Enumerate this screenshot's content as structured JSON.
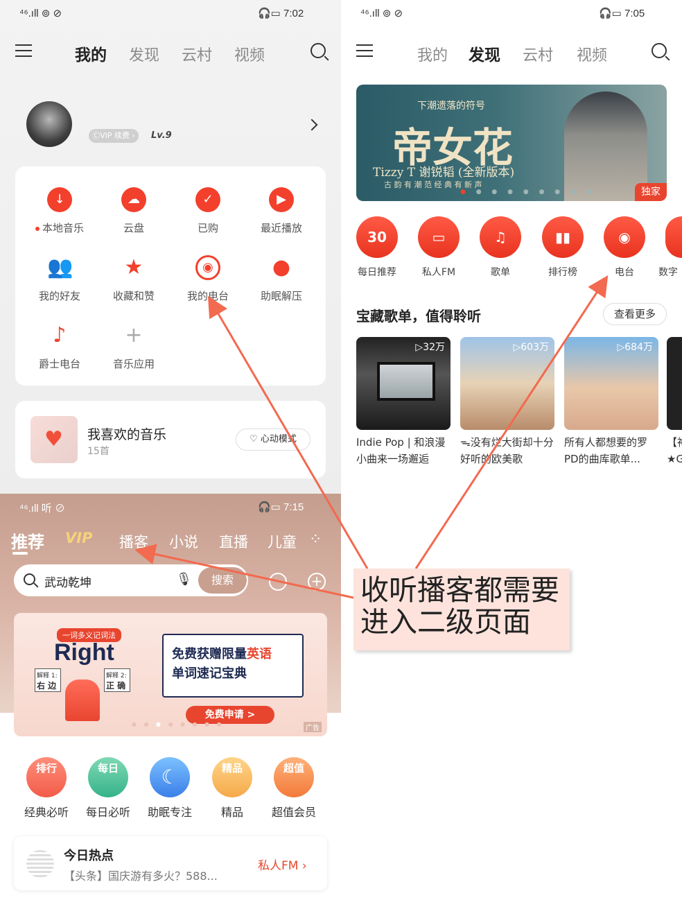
{
  "colors": {
    "accent": "#f2402d",
    "annotation_bg": "#fde3dc",
    "arrow": "#f26a4f"
  },
  "panel_a": {
    "status": {
      "left": "⁴⁶.ıll ⊚ ⊘",
      "time": "7:02"
    },
    "tabs": [
      "我的",
      "发现",
      "云村",
      "视频"
    ],
    "profile": {
      "vip_badge": "ⒸVIP 续费 ›",
      "level": "Lv.9"
    },
    "grid": [
      {
        "label": "本地音乐",
        "icon": "download-icon"
      },
      {
        "label": "云盘",
        "icon": "cloud-upload-icon"
      },
      {
        "label": "已购",
        "icon": "check-icon"
      },
      {
        "label": "最近播放",
        "icon": "play-icon"
      },
      {
        "label": "我的好友",
        "icon": "friends-icon"
      },
      {
        "label": "收藏和赞",
        "icon": "star-icon"
      },
      {
        "label": "我的电台",
        "icon": "radio-icon"
      },
      {
        "label": "助眠解压",
        "icon": "moon-icon"
      },
      {
        "label": "爵士电台",
        "icon": "saxophone-icon"
      },
      {
        "label": "音乐应用",
        "icon": "plus-icon"
      }
    ],
    "liked": {
      "title": "我喜欢的音乐",
      "count": "15首",
      "mode": "心动模式"
    }
  },
  "panel_b": {
    "status": {
      "left": "⁴⁶.ıll ⊚ ⊘",
      "time": "7:05"
    },
    "tabs": [
      "我的",
      "发现",
      "云村",
      "视频"
    ],
    "banner": {
      "top_text": "下潮遗落的符号",
      "title": "帝女花",
      "subtitle": "Tizzy T 谢锐韬 (全新版本)",
      "tagline": "古 韵 有 潮 范   经 典 有 新 声",
      "badge": "独家"
    },
    "categories": [
      {
        "label": "每日推荐",
        "icon_text": "30"
      },
      {
        "label": "私人FM",
        "icon_text": "▭"
      },
      {
        "label": "歌单",
        "icon_text": "♫"
      },
      {
        "label": "排行榜",
        "icon_text": "▮▮"
      },
      {
        "label": "电台",
        "icon_text": "◉"
      },
      {
        "label": "数字",
        "icon_text": ""
      }
    ],
    "section": {
      "title": "宝藏歌单，值得聆听",
      "more": "查看更多"
    },
    "playlists": [
      {
        "count": "▷32万",
        "title": "Indie Pop | 和浪漫小曲来一场邂逅"
      },
      {
        "count": "▷603万",
        "title": "ᯓ没有烂大街却十分好听的欧美歌"
      },
      {
        "count": "▷684万",
        "title": "所有人都想要的罗PD的曲库歌单..."
      },
      {
        "count": "",
        "title": "【神★G"
      }
    ]
  },
  "panel_c": {
    "status": {
      "left": "⁴⁶.ıll 听 ⊘",
      "time": "7:15"
    },
    "tabs": [
      "推荐",
      "VIP",
      "播客",
      "小说",
      "直播",
      "儿童"
    ],
    "search": {
      "query": "武动乾坤",
      "button": "搜索"
    },
    "ad": {
      "tag": "一词多义记词法",
      "word": "Right",
      "meaning1_label": "解释 1:",
      "meaning1": "右 边",
      "meaning2_label": "解释 2:",
      "meaning2": "正 确",
      "bubble_line1": "免费获赠限量",
      "bubble_highlight": "英语",
      "bubble_line2": "单词速记宝典",
      "cta": "免费申请 >",
      "ad_mark": "广告"
    },
    "quick": [
      {
        "label": "经典必听",
        "icon_text": "排行"
      },
      {
        "label": "每日必听",
        "icon_text": "每日"
      },
      {
        "label": "助眠专注",
        "icon_text": "☾"
      },
      {
        "label": "精品",
        "icon_text": "精品"
      },
      {
        "label": "超值会员",
        "icon_text": "超值"
      }
    ],
    "hot": {
      "title": "今日热点",
      "text": "【头条】国庆游有多火？588...",
      "fm": "私人FM ›"
    }
  },
  "annotation": {
    "line1": "收听播客都需要",
    "line2": "进入二级页面"
  }
}
